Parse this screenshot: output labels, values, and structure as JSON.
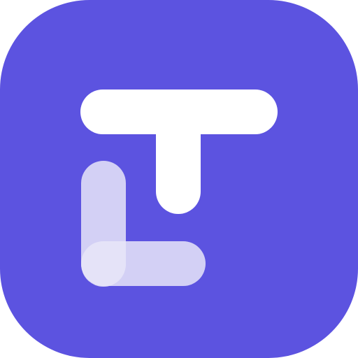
{
  "app_icon": {
    "name": "lt-app-icon",
    "colors": {
      "background": "#5C53E0",
      "t_mark": "#FFFFFF",
      "l_mark": "#E8E6F8"
    },
    "glyphs": [
      "L",
      "T"
    ]
  }
}
